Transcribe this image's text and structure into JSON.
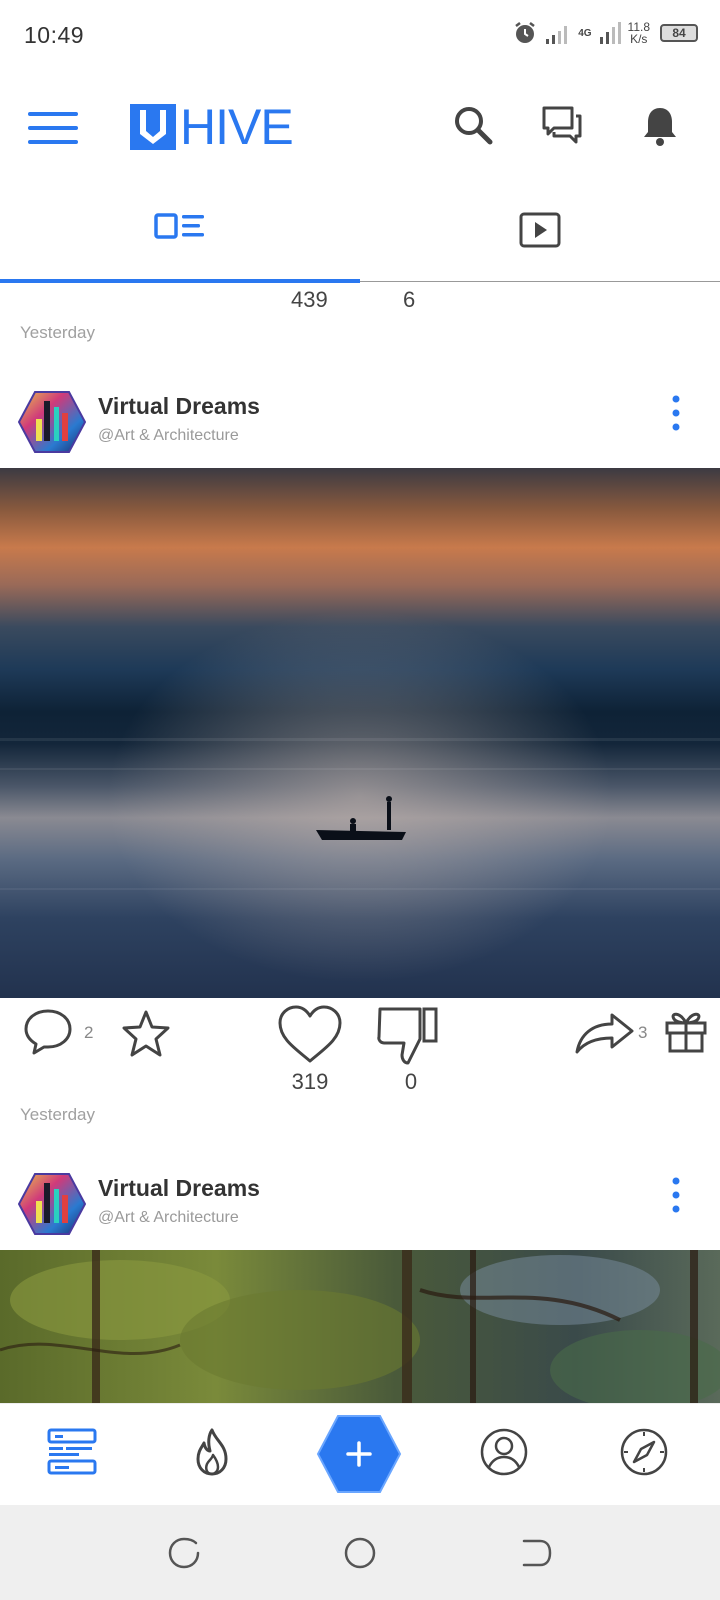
{
  "status_bar": {
    "time": "10:49",
    "network": "4G",
    "speed_value": "11.8",
    "speed_unit": "K/s",
    "battery": "84"
  },
  "header": {
    "logo_text": "HIVE",
    "brand_color": "#2a78f0",
    "icons": [
      "menu-icon",
      "search-icon",
      "messages-icon",
      "notifications-icon"
    ]
  },
  "tabs": [
    {
      "name": "feed-tab",
      "icon": "posts-list-icon",
      "active": true
    },
    {
      "name": "video-tab",
      "icon": "video-play-icon",
      "active": false
    }
  ],
  "feed": {
    "previous_post": {
      "likes": "439",
      "dislikes": "6"
    },
    "posts": [
      {
        "date": "Yesterday",
        "author": "Virtual Dreams",
        "community": "@Art & Architecture",
        "image": "sunset lake with boat",
        "comments": "2",
        "likes": "319",
        "dislikes": "0",
        "shares": "3"
      },
      {
        "date": "Yesterday",
        "author": "Virtual Dreams",
        "community": "@Art & Architecture",
        "image": "forest painting"
      }
    ]
  },
  "bottom_nav": {
    "items": [
      "feed-icon",
      "trending-flame-icon",
      "create-post-icon",
      "profile-icon",
      "explore-compass-icon"
    ],
    "fab_label": "+"
  }
}
